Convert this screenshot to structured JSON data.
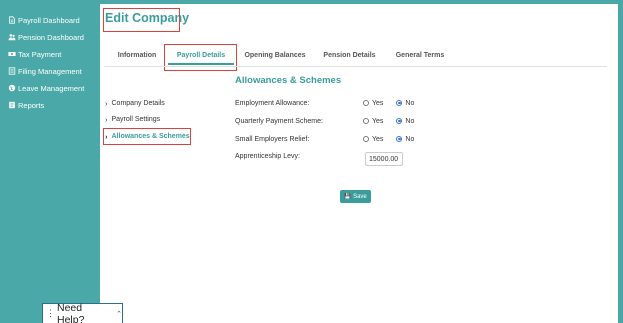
{
  "sidebar": {
    "items": [
      {
        "label": "Payroll Dashboard",
        "icon": "document-icon"
      },
      {
        "label": "Pension Dashboard",
        "icon": "people-icon"
      },
      {
        "label": "Tax Payment",
        "icon": "money-icon"
      },
      {
        "label": "Filing Management",
        "icon": "file-icon"
      },
      {
        "label": "Leave Management",
        "icon": "globe-icon"
      },
      {
        "label": "Reports",
        "icon": "report-icon"
      }
    ]
  },
  "page": {
    "title": "Edit Company"
  },
  "tabs": [
    {
      "label": "Information"
    },
    {
      "label": "Payroll Details"
    },
    {
      "label": "Opening Balances"
    },
    {
      "label": "Pension Details"
    },
    {
      "label": "General Terms"
    }
  ],
  "active_tab": "Payroll Details",
  "left_nav": [
    {
      "label": "Company Details"
    },
    {
      "label": "Payroll Settings"
    },
    {
      "label": "Allowances & Schemes"
    }
  ],
  "section": {
    "title": "Allowances & Schemes"
  },
  "form": {
    "employment_allowance": {
      "label": "Employment Allowance:",
      "yes": "Yes",
      "no": "No",
      "selected": "No"
    },
    "quarterly_payment": {
      "label": "Quarterly Payment Scheme:",
      "yes": "Yes",
      "no": "No",
      "selected": "No"
    },
    "small_employers_relief": {
      "label": "Small Employers Relief:",
      "yes": "Yes",
      "no": "No",
      "selected": "No"
    },
    "apprenticeship_levy": {
      "label": "Apprenticeship Levy:",
      "value": "15000.00"
    }
  },
  "save_button": {
    "label": "Save"
  },
  "help": {
    "label": "Need Help?"
  },
  "colors": {
    "teal": "#4aa9a8",
    "accent": "#3a9d9c",
    "highlight": "#d9433b",
    "radio": "#3a6fd8"
  }
}
